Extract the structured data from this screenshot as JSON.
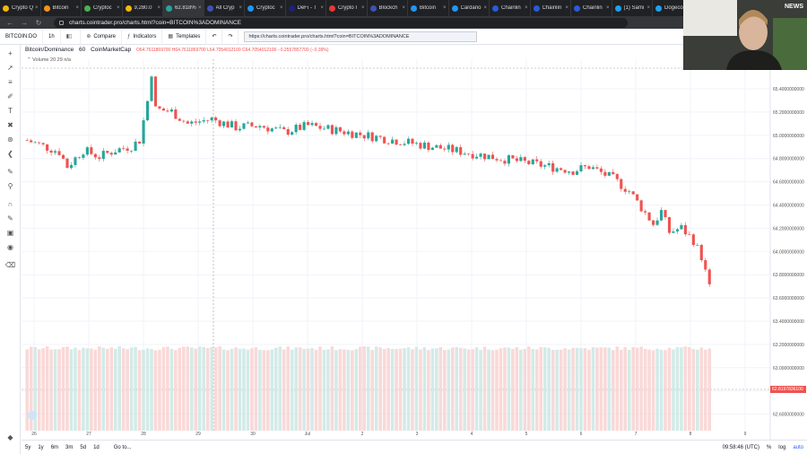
{
  "browser": {
    "tabs": [
      {
        "title": "Crypto Q",
        "color": "#f0b90b"
      },
      {
        "title": "Bitcoin",
        "color": "#f7931a"
      },
      {
        "title": "Cryptoc",
        "color": "#4caf50"
      },
      {
        "title": "9,280.0",
        "color": "#f0b90b"
      },
      {
        "title": "62.818%",
        "color": "#26a69a",
        "active": true
      },
      {
        "title": "All Cryp",
        "color": "#3f51b5"
      },
      {
        "title": "Cryptoc",
        "color": "#2196f3"
      },
      {
        "title": "DeFi - T",
        "color": "#1a237e"
      },
      {
        "title": "Crypto I",
        "color": "#e53935"
      },
      {
        "title": "Blockch",
        "color": "#3f51b5"
      },
      {
        "title": "Bitcoin",
        "color": "#2196f3"
      },
      {
        "title": "Cardano",
        "color": "#2196f3"
      },
      {
        "title": "Chainlin",
        "color": "#2a5ada"
      },
      {
        "title": "Chainlin",
        "color": "#2a5ada"
      },
      {
        "title": "Chainlin",
        "color": "#2a5ada"
      },
      {
        "title": "(1) Sami",
        "color": "#1da1f2"
      },
      {
        "title": "Dogeco",
        "color": "#1da1f2"
      }
    ],
    "url": "charts.cointrader.pro/charts.html?coin=BITCOIN%3ADOMINANCE"
  },
  "toolbar": {
    "symbol": "BITCOIN:DO",
    "interval": "1h",
    "compare": "Compare",
    "indicators": "Indicators",
    "templates": "Templates",
    "chart_url": "https://charts.cointrader.pro/charts.html?coin=BITCOIN%3ADOMINANCE"
  },
  "legend": {
    "title": "Bitcoin/Dominance",
    "interval": "60",
    "source": "CoinMarketCap",
    "ohlc": "O64.7611869700  H64.7611869700  L64.7054012100  C64.7054012100  −0.2557857700 (−0.39%)",
    "volume": "Volume 20",
    "volume_values": "29  n/a"
  },
  "bottombar": {
    "ranges": [
      "5y",
      "1y",
      "6m",
      "3m",
      "5d",
      "1d"
    ],
    "goto": "Go to...",
    "time": "09:58:46 (UTC)",
    "pct": "%",
    "log": "log",
    "auto": "auto"
  },
  "webcam": {
    "badge": "NEWS"
  },
  "chart_data": {
    "type": "candlestick",
    "x_tick_labels": [
      "26",
      "27",
      "28",
      "29",
      "30",
      "Jul",
      "2",
      "3",
      "4",
      "5",
      "6",
      "7",
      "8",
      "9"
    ],
    "y_tick_labels": [
      "65.4000000000",
      "65.2000000000",
      "65.0000000000",
      "64.8000000000",
      "64.6000000000",
      "64.4000000000",
      "64.2000000000",
      "64.0000000000",
      "63.8000000000",
      "63.6000000000",
      "63.4000000000",
      "63.2000000000",
      "63.0000000000",
      "62.8000000000",
      "62.6000000000"
    ],
    "ylim": [
      62.5,
      65.5
    ],
    "last_price_label": "62.8197836100",
    "last_price": 62.82,
    "close_path": [
      [
        0,
        64.62
      ],
      [
        4,
        64.55
      ],
      [
        8,
        64.48
      ],
      [
        10,
        64.3
      ],
      [
        14,
        64.5
      ],
      [
        18,
        64.42
      ],
      [
        22,
        64.5
      ],
      [
        26,
        64.55
      ],
      [
        28,
        64.62
      ],
      [
        30,
        65.1
      ],
      [
        31,
        65.45
      ],
      [
        32,
        65.0
      ],
      [
        36,
        64.97
      ],
      [
        40,
        64.82
      ],
      [
        46,
        64.88
      ],
      [
        52,
        64.78
      ],
      [
        58,
        64.8
      ],
      [
        64,
        64.72
      ],
      [
        70,
        64.8
      ],
      [
        76,
        64.75
      ],
      [
        82,
        64.7
      ],
      [
        88,
        64.65
      ],
      [
        94,
        64.6
      ],
      [
        100,
        64.55
      ],
      [
        106,
        64.5
      ],
      [
        112,
        64.45
      ],
      [
        118,
        64.4
      ],
      [
        124,
        64.35
      ],
      [
        130,
        64.3
      ],
      [
        136,
        64.25
      ],
      [
        140,
        64.3
      ],
      [
        146,
        64.15
      ],
      [
        150,
        64.0
      ],
      [
        153,
        63.8
      ],
      [
        156,
        63.6
      ],
      [
        158,
        63.75
      ],
      [
        160,
        63.5
      ],
      [
        163,
        63.55
      ],
      [
        166,
        63.4
      ],
      [
        168,
        63.2
      ],
      [
        170,
        62.82
      ]
    ],
    "volume_level": 0.82
  }
}
